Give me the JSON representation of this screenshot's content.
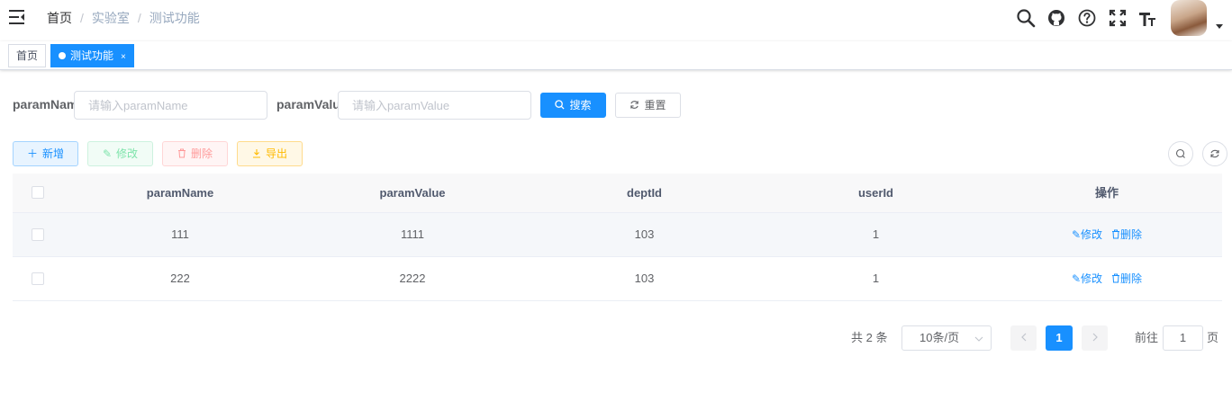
{
  "navbar": {
    "breadcrumb": [
      "首页",
      "实验室",
      "测试功能"
    ],
    "icons": [
      "hamburger-icon",
      "search-icon",
      "github-icon",
      "question-icon",
      "fullscreen-icon",
      "font-size-icon"
    ]
  },
  "tags": [
    {
      "label": "首页",
      "active": false
    },
    {
      "label": "测试功能",
      "active": true,
      "close": "×"
    }
  ],
  "search": {
    "param_name_label": "paramName",
    "param_name_placeholder": "请输入paramName",
    "param_value_label": "paramValue",
    "param_value_placeholder": "请输入paramValue",
    "search_label": "搜索",
    "reset_label": "重置"
  },
  "toolbar": {
    "add_label": "新增",
    "edit_label": "修改",
    "delete_label": "删除",
    "export_label": "导出"
  },
  "table": {
    "headers": [
      "paramName",
      "paramValue",
      "deptId",
      "userId",
      "操作"
    ],
    "rows": [
      {
        "paramName": "111",
        "paramValue": "1111",
        "deptId": "103",
        "userId": "1"
      },
      {
        "paramName": "222",
        "paramValue": "2222",
        "deptId": "103",
        "userId": "1"
      }
    ],
    "row_edit_label": "修改",
    "row_delete_label": "删除"
  },
  "pagination": {
    "total_text": "共 2 条",
    "page_size": "10条/页",
    "current_page": "1",
    "goto_prefix": "前往",
    "goto_value": "1",
    "goto_suffix": "页"
  },
  "colors": {
    "primary": "#1890ff",
    "success": "#13ce66",
    "danger": "#ff4949",
    "warning": "#ffba00"
  }
}
